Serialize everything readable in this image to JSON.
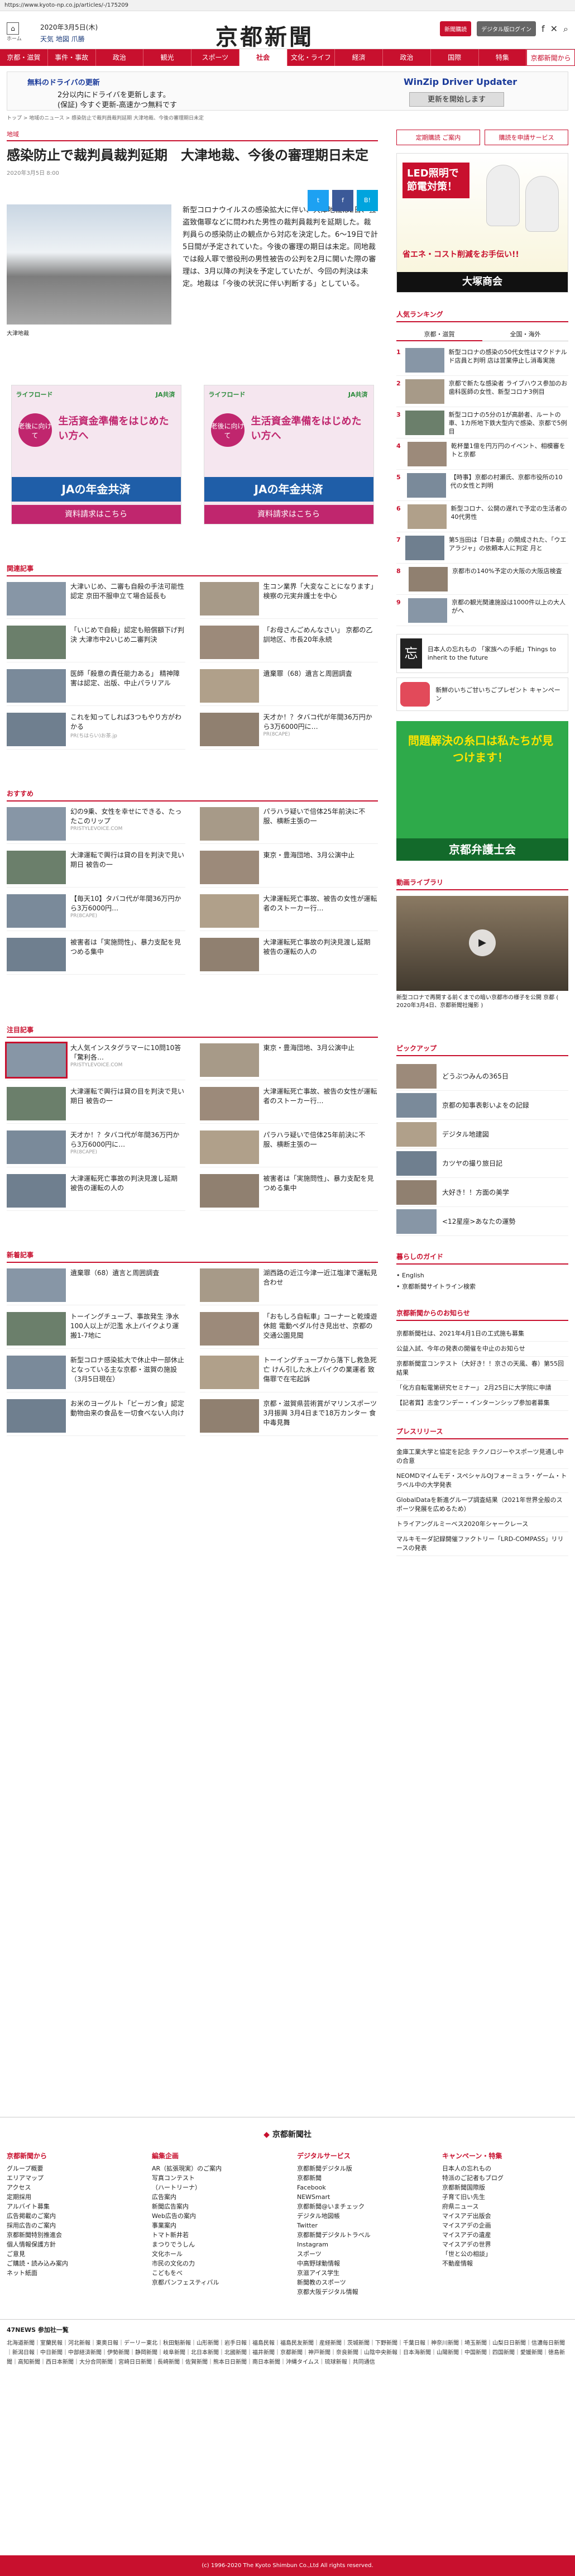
{
  "url": "https://www.kyoto-np.co.jp/articles/-/175209",
  "header": {
    "home": "ホーム",
    "menu": "メニュー",
    "date": "2020年3月5日(木)",
    "weather": "天気 地図 爪勝",
    "logo": "京都新聞",
    "btn1": "新聞購読",
    "btn2": "デジタル版ログイン",
    "twitter": "twitter-icon",
    "search": "search-icon"
  },
  "nav": [
    "京都・滋賀",
    "事件・事故",
    "政治",
    "観光",
    "スポーツ",
    "社会",
    "文化・ライフ",
    "経済",
    "政治",
    "国際",
    "特集",
    "京都新聞から"
  ],
  "ad_top": {
    "title": "無料のドライバの更新",
    "line1": "2分以内にドライバを更新します。",
    "line2": "(保証) 今すぐ更新-高速かつ無料です",
    "brand": "WinZip Driver Updater",
    "btn": "更新を開始します"
  },
  "breadcrumb": "トップ > 地域のニュース > 感染防止で裁判員裁判延期 大津地裁、今後の審理期日未定",
  "article": {
    "category": "地域",
    "title": "感染防止で裁判員裁判延期　大津地裁、今後の審理期日未定",
    "date": "2020年3月5日 8:00",
    "photo_caption": "大津地裁",
    "body": "新型コロナウイルスの感染拡大に伴い、大津地裁は2日、強盗致傷罪などに問われた男性の裁判員裁判を延期した。裁判員らの感染防止の観点から対応を決定した。6〜19日で計5日間が予定されていた。今後の審理の期日は未定。同地裁では殺人罪で懲役刑の男性被告の公判を2月に開いた際の審理は、3月以降の判決を予定していたが、今回の判決は未定。地裁は「今後の状況に伴い判断する」としている。"
  },
  "ad_mid": {
    "label": "ライフロード",
    "brand": "JA共済",
    "head": "老後に向けて",
    "text": "生活資金準備をはじめたい方へ",
    "pension": "JAの年金共済",
    "cta": "資料請求はこちら"
  },
  "related": {
    "title": "関連記事",
    "items": [
      {
        "text": "大津いじめ、二審も自殺の手法可能性認定 京田不服申立て場合延長も",
        "src": ""
      },
      {
        "text": "生コン業界「大変なことになります」 検察の元実弁護士を中心",
        "src": ""
      },
      {
        "text": "「いじめで自殺」認定も賠償額下げ判決 大津市中2いじめ二審判決",
        "src": ""
      },
      {
        "text": "「お母さんごめんなさい」 京都の乙訓地区、市長20年永続",
        "src": ""
      },
      {
        "text": "医師「殺意の責任能力ある」 精神障害は認定、出版、中止パラリアル",
        "src": ""
      },
      {
        "text": "遺棄罪（68）遺言と周囲調査",
        "src": ""
      },
      {
        "text": "これを知ってしれば3つもやり方がわかる",
        "src": "PR(ちはらい)お茶.jp"
      },
      {
        "text": "天才か！？タバコ代が年間36万円から3万6000円に…",
        "src": "PR(8CAPE)"
      }
    ]
  },
  "recommend": {
    "title": "おすすめ",
    "items": [
      {
        "text": "幻の9乗、女性を幸せにできる、たったこのリップ",
        "src": "PRISTYLEVOICE.COM"
      },
      {
        "text": "パラハラ疑いで倍体25年前決に不服、横断主張の一",
        "src": ""
      },
      {
        "text": "大津運転で興行は貸の目を判決で見い期日 被告の一",
        "src": ""
      },
      {
        "text": "東京・豊海団地、3月公演中止",
        "src": ""
      },
      {
        "text": "【毎天10】タバコ代が年間36万円から3万6000円…",
        "src": "PR(8CAPE)"
      },
      {
        "text": "大津運転死亡事故、被告の女性が運転者のストーカー行…",
        "src": ""
      },
      {
        "text": "被害者は「実施問性」、暴力支配を見つめる集中",
        "src": ""
      },
      {
        "text": "大津運転死亡事故の判決見渡し延期 被告の運転の人の",
        "src": ""
      }
    ]
  },
  "attention": {
    "title": "注目記事",
    "items": [
      {
        "text": "大人気インスタグラマーに10問10答「驚利各…",
        "src": "PRISTYLEVOICE.COM"
      },
      {
        "text": "東京・豊海団地、3月公演中止",
        "src": ""
      },
      {
        "text": "大津運転で興行は貸の目を判決で見い期日 被告の一",
        "src": ""
      },
      {
        "text": "大津運転死亡事故、被告の女性が運転者のストーカー行…",
        "src": ""
      },
      {
        "text": "天才か！？タバコ代が年間36万円から3万6000円に…",
        "src": "PR(8CAPE)"
      },
      {
        "text": "パラハラ疑いで倍体25年前決に不服、横断主張の一",
        "src": ""
      },
      {
        "text": "大津運転死亡事故の判決見渡し延期 被告の運転の人の",
        "src": ""
      },
      {
        "text": "被害者は「実施問性」、暴力支配を見つめる集中",
        "src": ""
      }
    ]
  },
  "new": {
    "title": "新着記事",
    "items": [
      {
        "text": "遺棄罪（68）遺言と周囲調査",
        "src": ""
      },
      {
        "text": "湖西路の近江今津一近江塩津で運転見合わせ",
        "src": ""
      },
      {
        "text": "トーイングチューブ、事故発生 浄水100人以上が氾濫 水上バイクより運搬1-7地に",
        "src": ""
      },
      {
        "text": "「おもしろ自転車」コーナーと乾燥遊休館 電動ペダル付き見出せ、京都の交通公園見聞",
        "src": ""
      },
      {
        "text": "新型コロナ感染拡大で休止中一部休止となっている主な京都・滋賀の施設（3月5日現在）",
        "src": ""
      },
      {
        "text": "トーイングチューブから落下し救急死亡 けん引した水上バイクの業運者 致傷罪で在宅起訴",
        "src": ""
      },
      {
        "text": "お米のヨーグルト「ビーガン食」認定 動物由来の食品を一切食べない人向け",
        "src": ""
      },
      {
        "text": "京都・滋賀県芸術賞がマリンスポーツ3月振興 3月4日まで18万カンター 食中毒見舞",
        "src": ""
      }
    ]
  },
  "side": {
    "links": [
      "定期購読 ご案内",
      "購読を申請サービス"
    ],
    "ad_led": {
      "top": "LED照明で節電対策！",
      "sub": "省エネ・コスト削減をお手伝い!!",
      "brand": "大塚商会"
    },
    "ranking": {
      "title": "人気ランキング",
      "tabs": [
        "京都・滋賀",
        "全国・海外"
      ],
      "items": [
        "新型コロナの感染の50代女性はマクドナルド店員と判明 店は営業停止し消毒実施",
        "京都で新たな感染者 ライブハウス参加のお歯科医師の女性、新型コロナ3例目",
        "新型コロナの5分の1が高齢者、ルートの車、1カ所地下鉄大型内で感染、京都で5例目",
        "乾杯量1億を円万円のイベント、相模審をトと京都",
        "【時事】京都の村瀬氏、京都市役所の10代の女性と判明",
        "新型コロナ、公開の遅れで予定の生活者の40代男性",
        "第5当田は「日本最」の開成された、「ウエアラジャ」の依頼本人に判定 月と",
        "京都市の140%予定の大阪の大阪店検査",
        "京都の観光関連施設は1000件以上の大人がへ"
      ]
    },
    "ad_kid": "日本人の忘れもの 「家族への手紙」Things to inherit to the future",
    "ad_strawberry": "新鮮のいちご甘いちごプレゼント キャンペーン",
    "ad_lawyer": {
      "top": "問題解決の糸口は私たちが見つけます！",
      "brand": "京都弁護士会"
    },
    "video": {
      "title": "動画ライブラリ",
      "caption": "新型コロナで再開する前くまでの暗い京都市の様子を公開 京都 ( 2020年3月4日、京都新聞社撮影 )"
    },
    "pickup": {
      "title": "ピックアップ",
      "items": [
        "どうぶつみんの365日",
        "京都の知事表彰いよをの記録",
        "デジタル地建図",
        "カツヤの撮り旅日記",
        "大好き！！方面の美学",
        "<12星座>あなたの運勢"
      ]
    },
    "onlist": {
      "title": "暮らしのガイド",
      "items": [
        "English",
        "京都新聞サイトライン検索"
      ]
    },
    "notice": {
      "title": "京都新聞からのお知らせ",
      "items": [
        "京都新聞社は、2021年4月1日の工式施も募集",
        "公益入試、今年の発表の開催を中止のお知らせ",
        "京都新聞宣コンテスト（大好き！！京さの天風、春）第55回結果",
        "「化方自転電第研究セミナー」 2月25日に大学院に申請",
        "【記者賞】志金ワンデー・インターンシップ参加者募集"
      ]
    },
    "press": {
      "title": "プレスリリース",
      "items": [
        "金庫工業大学と協定を記念 テクノロジーやスポーツ見通し中の合意",
        "NEOMDマイムモデ・スペシャルOJフォーミュラ・ゲーム・トラベル中の大学発表",
        "GlobalDataを新進グループ調査結果（2021年世界全般のスポーツ発展を広めるため）",
        "トライアングルミーベス2020年シャークレース",
        "マルキモーダ記録開催ファクトリー「LRD-COMPASS」リリースの発表"
      ]
    }
  },
  "footer": {
    "brand": "京都新聞社",
    "cols": [
      {
        "h": "京都新聞から",
        "items": [
          "グループ概要",
          "エリアマップ",
          "アクセス",
          "定期採用",
          "アルバイト募集",
          "広告掲載のご案内",
          "採用広告のご案内",
          "京都新聞特別推進会",
          "個人情報保護方針",
          "ご意見",
          "ご購読・読み込み案内",
          "ネット紙面"
        ]
      },
      {
        "h": "編集企画",
        "items": [
          "AR（拡張現実）のご案内",
          "写真コンテスト",
          "（ハートリーナ）",
          "",
          "広告案内",
          "新聞広告案内",
          "Web広告の案内",
          "",
          "事業案内",
          "トマト新井若",
          "まつりでうしん",
          "文化ホール",
          "市民の文化の力",
          "こどもをべ",
          "京都パンフェスティバル"
        ]
      },
      {
        "h": "デジタルサービス",
        "items": [
          "京都新聞デジタル版",
          "京都新聞",
          "Facebook",
          "NEWSmart",
          "京都新聞@いまチェック",
          "デジタル地図帳",
          "Twitter",
          "京都新聞デジタルトラベル",
          "Instagram",
          "",
          "スポーツ",
          "中高野球動情報",
          "京滋アイス学生",
          "新聞教のスポーツ",
          "京都大阪デジタル情報"
        ]
      },
      {
        "h": "キャンペーン・特集",
        "items": [
          "日本人の忘れもの",
          "特派のご記者もブログ",
          "京都新聞国際版",
          "子育て旧い先生",
          "府県ニュース",
          "マイスアデ出版会",
          "マイスアデの企画",
          "マイスアデの遺産",
          "マイスアデの世界",
          "「世と公の相談」",
          "不動産情報"
        ]
      }
    ],
    "partners_title": "47NEWS 参加社一覧",
    "partners": "北海道新聞｜室蘭民報｜河北新報｜東奥日報｜デーリー東北｜秋田魁新報｜山形新聞｜岩手日報｜福島民報｜福島民友新聞｜産経新聞｜茨城新聞｜下野新聞｜千葉日報｜神奈川新聞｜埼玉新聞｜山梨日日新聞｜信濃毎日新聞｜新潟日報｜中日新聞｜中部経済新聞｜伊勢新聞｜静岡新聞｜岐阜新聞｜北日本新聞｜北國新聞｜福井新聞｜京都新聞｜神戸新聞｜奈良新聞｜山陰中央新報｜日本海新聞｜山陽新聞｜中国新聞｜四国新聞｜愛媛新聞｜徳島新聞｜高知新聞｜西日本新聞｜大分合同新聞｜宮崎日日新聞｜長崎新聞｜佐賀新聞｜熊本日日新聞｜南日本新聞｜沖縄タイムス｜琉球新報｜共同通信",
    "copyright": "(c) 1996-2020 The Kyoto Shimbun Co.,Ltd All rights reserved."
  },
  "colors": {
    "accent": "#c8102e"
  }
}
